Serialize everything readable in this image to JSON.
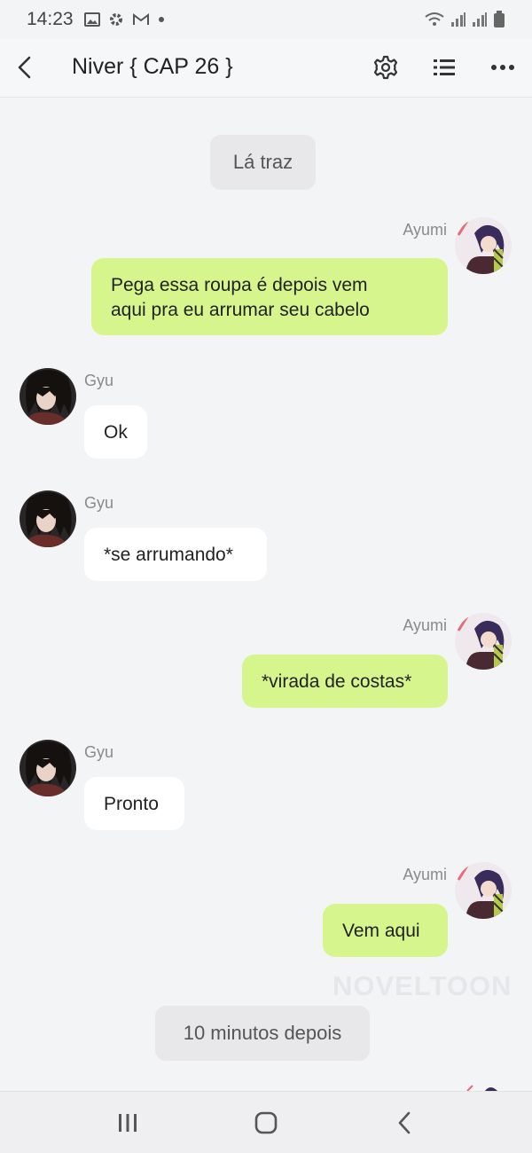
{
  "status_bar": {
    "time": "14:23",
    "icons": [
      "image-icon",
      "gear-icon",
      "gmail-icon",
      "dot-icon"
    ],
    "right_icons": [
      "wifi-icon",
      "signal-icon",
      "signal-icon",
      "battery-icon"
    ]
  },
  "header": {
    "title": "Niver { CAP 26 }",
    "icons": [
      "back-icon",
      "settings-icon",
      "list-icon",
      "more-icon"
    ]
  },
  "messages": [
    {
      "type": "narration",
      "text": "Lá traz"
    },
    {
      "type": "message",
      "side": "right",
      "sender": "Ayumi",
      "lines": [
        "Pega essa roupa é depois vem",
        "aqui pra eu arrumar seu cabelo"
      ]
    },
    {
      "type": "message",
      "side": "left",
      "sender": "Gyu",
      "lines": [
        "Ok"
      ]
    },
    {
      "type": "message",
      "side": "left",
      "sender": "Gyu",
      "lines": [
        "*se arrumando*"
      ]
    },
    {
      "type": "message",
      "side": "right",
      "sender": "Ayumi",
      "lines": [
        "*virada de costas*"
      ]
    },
    {
      "type": "message",
      "side": "left",
      "sender": "Gyu",
      "lines": [
        "Pronto"
      ]
    },
    {
      "type": "message",
      "side": "right",
      "sender": "Ayumi",
      "lines": [
        "Vem aqui"
      ]
    },
    {
      "type": "narration",
      "text": "10 minutos depois"
    }
  ],
  "watermark": "NOVELTOON",
  "nav_bar": {
    "icons": [
      "recent-apps-icon",
      "home-icon",
      "back-icon"
    ]
  },
  "colors": {
    "my_bubble": "#d6f58c",
    "other_bubble": "#ffffff",
    "narration": "#e8e8ea",
    "background": "#f3f4f6"
  }
}
